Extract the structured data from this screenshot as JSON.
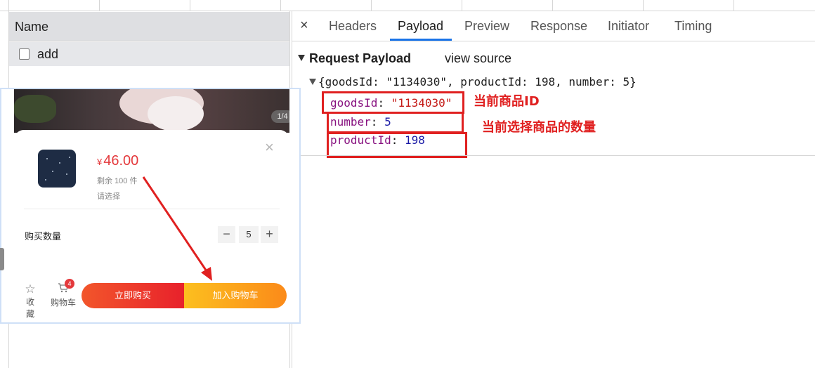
{
  "network": {
    "name_header": "Name",
    "requests": [
      {
        "name": "add"
      }
    ]
  },
  "details": {
    "close_icon": "×",
    "tabs": [
      {
        "label": "Headers"
      },
      {
        "label": "Payload"
      },
      {
        "label": "Preview"
      },
      {
        "label": "Response"
      },
      {
        "label": "Initiator"
      },
      {
        "label": "Timing"
      }
    ],
    "active_tab": "Payload",
    "payload": {
      "section_title": "Request Payload",
      "view_source": "view source",
      "object_summary": "{goodsId: \"1134030\", productId: 198, number: 5}",
      "props": [
        {
          "key": "goodsId",
          "value": "\"1134030\""
        },
        {
          "key": "number",
          "value": "5"
        },
        {
          "key": "productId",
          "value": "198"
        }
      ]
    },
    "annotations": {
      "goods_id": "当前商品ID",
      "quantity": "当前选择商品的数量"
    },
    "accent_color": "#1a73e8",
    "annotation_color": "#e02020"
  },
  "mobile": {
    "pager": "1/4",
    "price_symbol": "¥",
    "price": "46.00",
    "stock": "剩余 100 件",
    "choose": "请选择",
    "quantity_label": "购买数量",
    "quantity_value": "5",
    "minus": "−",
    "plus": "+",
    "close": "×",
    "favorite_label": "收藏",
    "cart_label": "购物车",
    "cart_badge": "4",
    "buy_now": "立即购买",
    "add_to_cart": "加入购物车",
    "price_color": "#e4393c"
  }
}
